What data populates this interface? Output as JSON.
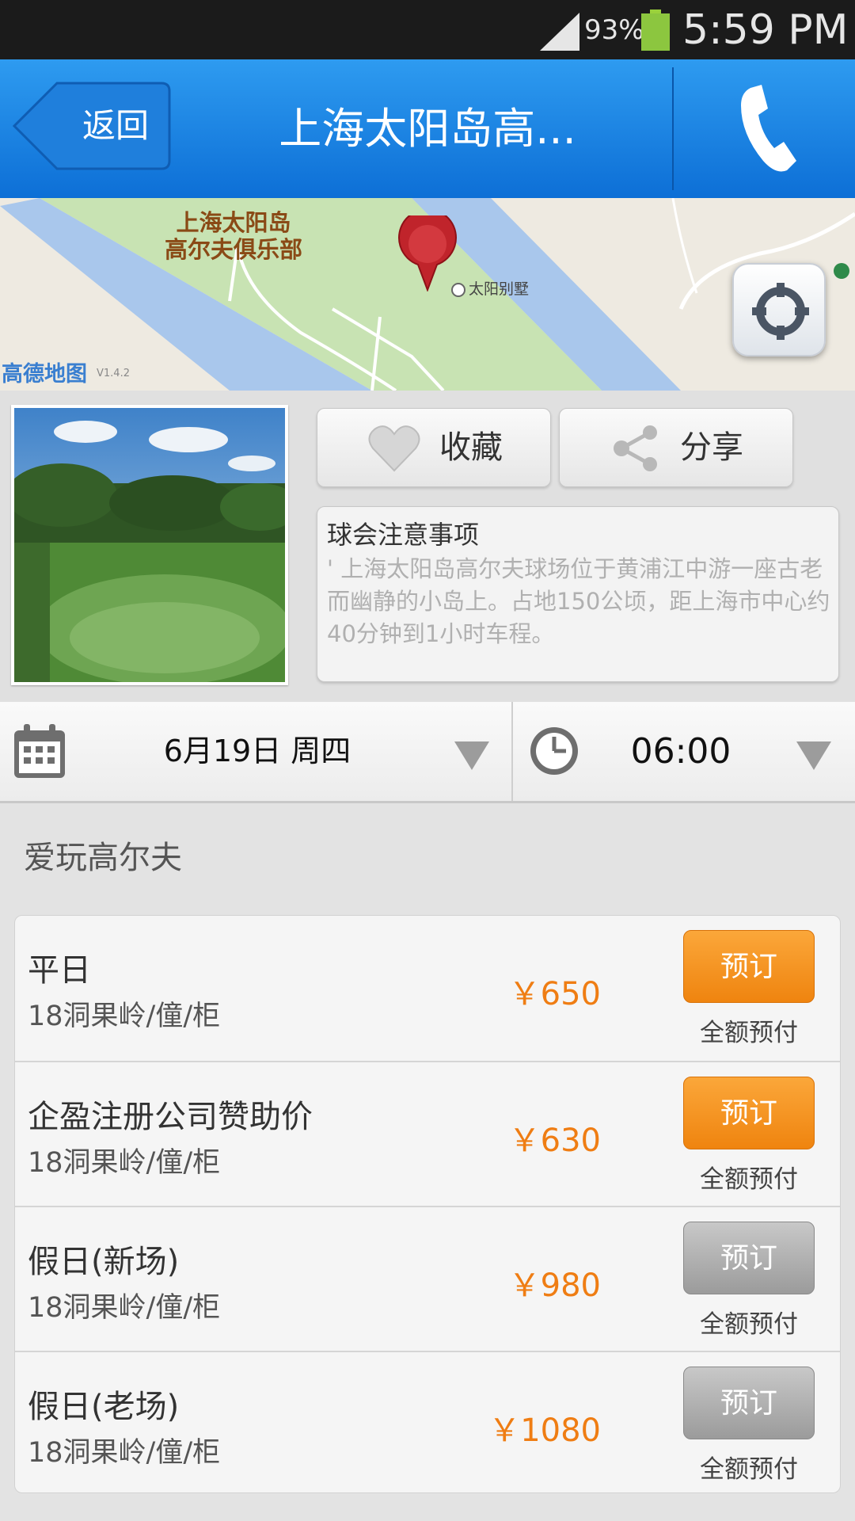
{
  "status_bar": {
    "battery_percent": "93%",
    "time": "5:59 PM"
  },
  "header": {
    "back_label": "返回",
    "title": "上海太阳岛高...",
    "phone_icon": "phone-icon"
  },
  "map": {
    "place_label_line1": "上海太阳岛",
    "place_label_line2": "高尔夫俱乐部",
    "poi_label": "太阳别墅",
    "provider_logo": "高德地图",
    "version": "V1.4.2",
    "colors": {
      "water": "#a9c7ec",
      "green": "#c8e3b3",
      "land": "#eeeae1",
      "pin": "#c0242b"
    }
  },
  "actions": {
    "favorite_label": "收藏",
    "share_label": "分享"
  },
  "notice": {
    "title": "球会注意事项",
    "body": "' 上海太阳岛高尔夫球场位于黄浦江中游一座古老而幽静的小岛上。占地150公顷，距上海市中心约40分钟到1小时车程。"
  },
  "picker": {
    "date": "6月19日 周四",
    "time": "06:00"
  },
  "section_title": "爱玩高尔夫",
  "prices": [
    {
      "name": "平日",
      "detail": "18洞果岭/僮/柜",
      "price": "￥650",
      "button": "预订",
      "payment": "全额预付",
      "enabled": true
    },
    {
      "name": "企盈注册公司赞助价",
      "detail": "18洞果岭/僮/柜",
      "price": "￥630",
      "button": "预订",
      "payment": "全额预付",
      "enabled": true
    },
    {
      "name": "假日(新场)",
      "detail": "18洞果岭/僮/柜",
      "price": "￥980",
      "button": "预订",
      "payment": "全额预付",
      "enabled": false
    },
    {
      "name": "假日(老场)",
      "detail": "18洞果岭/僮/柜",
      "price": "￥1080",
      "button": "预订",
      "payment": "全额预付",
      "enabled": false
    }
  ],
  "colors": {
    "header": "#1a86e6",
    "accent_orange": "#ef840f",
    "price": "#ef7d13",
    "disabled": "#a8a8a8"
  }
}
